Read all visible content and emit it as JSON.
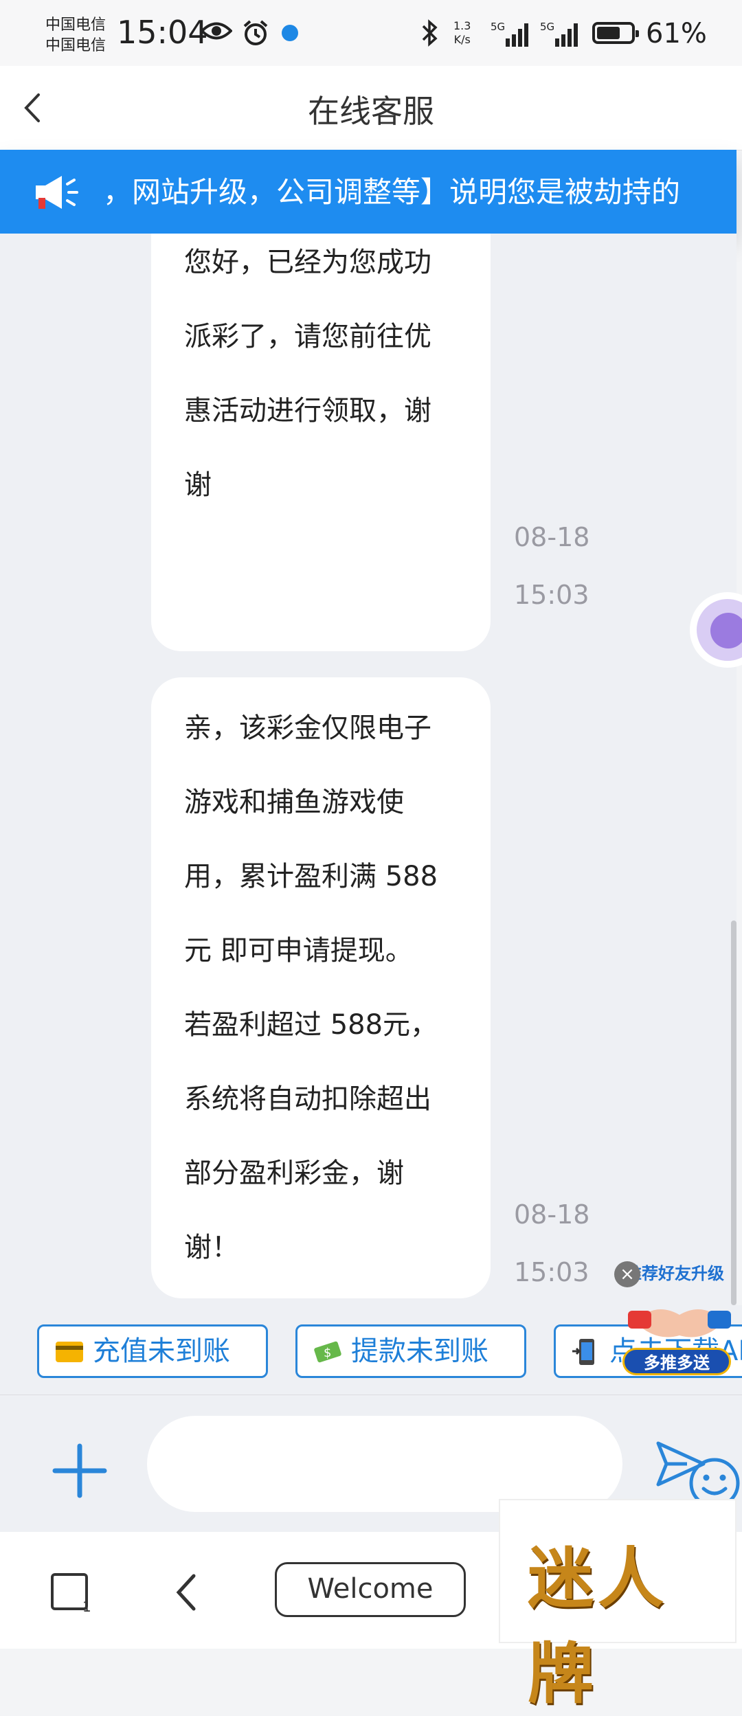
{
  "status_bar": {
    "carrier1": "中国电信",
    "carrier2": "中国电信",
    "time": "15:04",
    "net_speed_value": "1.3",
    "net_speed_unit": "K/s",
    "signal1": "5G",
    "signal2": "5G",
    "battery": "61%"
  },
  "header": {
    "title": "在线客服"
  },
  "notice": {
    "text": "，网站升级，公司调整等】说明您是被劫持的"
  },
  "messages": [
    {
      "lines": [
        "您好，已经为您成功",
        "派彩了，请您前往优",
        "惠活动进行领取，谢",
        "谢"
      ],
      "date": "08-18",
      "time": "15:03"
    },
    {
      "lines": [
        "亲，该彩金仅限电子",
        "游戏和捕鱼游戏使",
        "用，累计盈利满 588",
        "元 即可申请提现。",
        "若盈利超过 588元，",
        "系统将自动扣除超出",
        "部分盈利彩金，谢",
        "谢！"
      ],
      "date": "08-18",
      "time": "15:03"
    }
  ],
  "quick_replies": [
    {
      "label": "充值未到账",
      "icon": "credit-card-icon"
    },
    {
      "label": "提款未到账",
      "icon": "money-icon"
    },
    {
      "label": "点击下载APP",
      "icon": "phone-icon"
    }
  ],
  "promo": {
    "label": "推荐好友升级",
    "button": "多推多送"
  },
  "input": {
    "placeholder": ""
  },
  "bottom_nav": {
    "welcome": "Welcome",
    "tab_count": "1"
  },
  "brand": {
    "text": "迷人牌"
  },
  "colors": {
    "accent": "#1e8cf0",
    "chip_border": "#2a86d9"
  }
}
